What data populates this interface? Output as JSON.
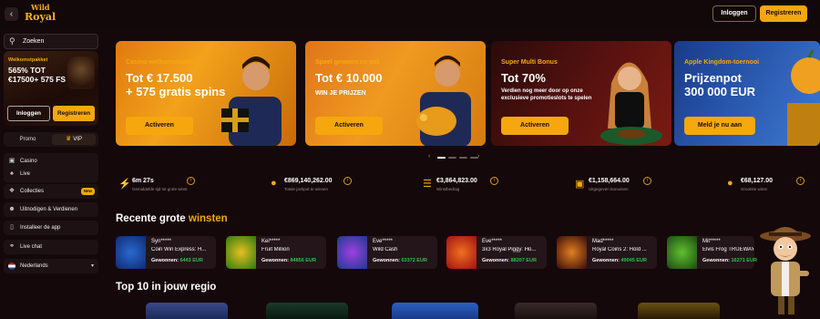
{
  "header": {
    "logo_line1": "Wild",
    "logo_line2": "Royal",
    "login_label": "Inloggen",
    "register_label": "Registreren"
  },
  "sidebar": {
    "search_placeholder": "Zoeken",
    "promo": {
      "title": "Welkomstpakket",
      "headline": "565% TOT €17500+ 575 FS",
      "login_label": "Inloggen",
      "register_label": "Registreren"
    },
    "tabs": {
      "promo": "Promo",
      "vip": "VIP"
    },
    "items": [
      {
        "label": "Casino",
        "icon": "slot-icon"
      },
      {
        "label": "Live",
        "icon": "live-icon"
      },
      {
        "label": "Collecties",
        "icon": "puzzle-icon",
        "badge": "New"
      },
      {
        "label": "Uitnodigen & Verdienen",
        "icon": "user-plus-icon"
      },
      {
        "label": "Installeer de app",
        "icon": "phone-icon"
      },
      {
        "label": "Live chat",
        "icon": "chat-icon"
      },
      {
        "label": "Nederlands",
        "icon": "flag-nl-icon"
      }
    ]
  },
  "banners": [
    {
      "tag": "Casino-welkomstpakket",
      "headline_1": "Tot € 17.500",
      "headline_2": "+ 575 gratis spins",
      "sub": "",
      "button": "Activeren"
    },
    {
      "tag": "Speel gewoon en pak",
      "headline_1": "Tot € 10.000",
      "headline_2": "",
      "sub": "WIN JE PRIJZEN",
      "button": "Activeren"
    },
    {
      "tag": "Super Multi Bonus",
      "headline_1": "Tot 70%",
      "headline_2": "",
      "sub": "Verdien nog meer door op onze exclusieve promotieslots te spelen",
      "button": "Activeren"
    },
    {
      "tag": "Apple Kingdom-toernooi",
      "headline_1": "Prijzenpot",
      "headline_2": "300 000 EUR",
      "sub": "",
      "button": "Meld je nu aan"
    }
  ],
  "stats": [
    {
      "value": "6m 27s",
      "label": "Gemiddelde tijd tot grote winst",
      "icon": "lightning-icon"
    },
    {
      "value": "€869,140,262.00",
      "label": "Totale jackpot te winnen",
      "icon": "money-bag-icon"
    },
    {
      "value": "€3,864,823.00",
      "label": "Winstbedrag",
      "icon": "coins-icon"
    },
    {
      "value": "€1,158,664.00",
      "label": "Uitgegeven bonussen",
      "icon": "gift-icon"
    },
    {
      "value": "€68,127.00",
      "label": "Grootste winst",
      "icon": "money-bag-icon"
    }
  ],
  "recent_wins": {
    "title_1": "Recente grote",
    "title_2": "winsten",
    "won_label": "Gewonnen:",
    "items": [
      {
        "user": "Syn*****",
        "game": "Coin Win Express: H...",
        "amount": "6443 EUR"
      },
      {
        "user": "Kei*****",
        "game": "Fruit Million",
        "amount": "84856 EUR"
      },
      {
        "user": "Eve*****",
        "game": "Wild Cash",
        "amount": "63372 EUR"
      },
      {
        "user": "Eve*****",
        "game": "3x3 Royal Piggy: Ho...",
        "amount": "88207 EUR"
      },
      {
        "user": "Mad*****",
        "game": "Royal Coins 2: Hold ...",
        "amount": "49045 EUR"
      },
      {
        "user": "Mit*****",
        "game": "Elvis Frog TRUEWAYS",
        "amount": "16271 EUR"
      }
    ]
  },
  "top10": {
    "title": "Top 10 in jouw regio"
  },
  "colors": {
    "accent": "#f5a70d",
    "background": "#15080b",
    "win_green": "#31c04a"
  }
}
